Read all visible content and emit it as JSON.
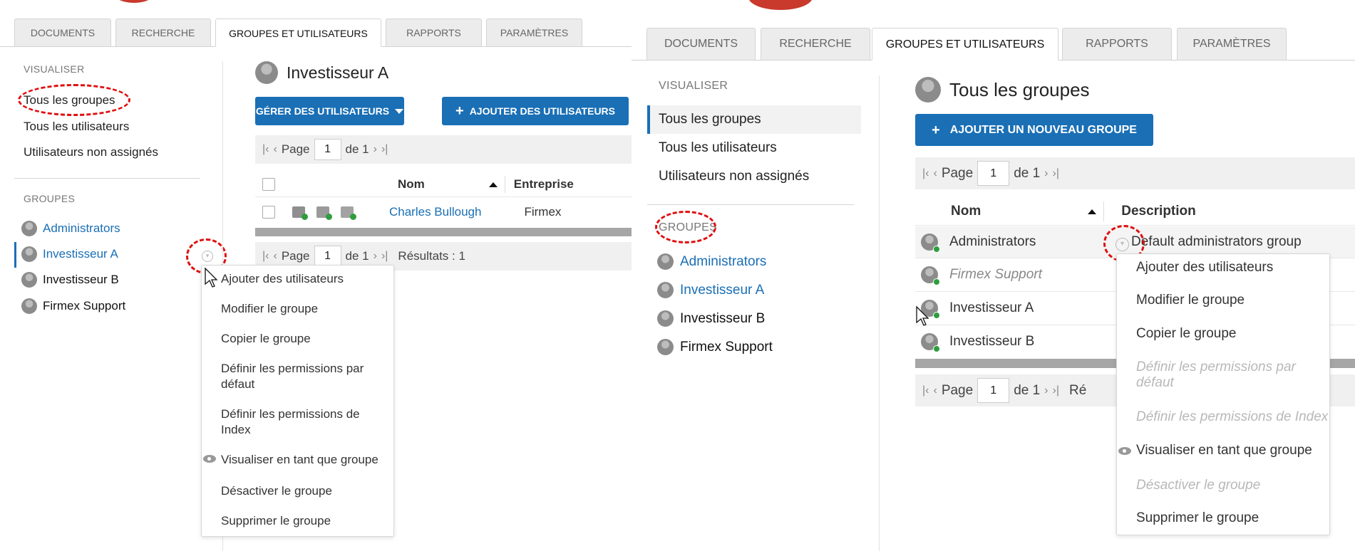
{
  "colors": {
    "accent": "#1a6fb5",
    "highlight": "#e01010",
    "success": "#2e9e3e",
    "logo": "#c9392c"
  },
  "tabs": [
    "DOCUMENTS",
    "RECHERCHE",
    "GROUPES ET UTILISATEURS",
    "RAPPORTS",
    "PARAMÈTRES"
  ],
  "active_tab": "GROUPES ET UTILISATEURS",
  "sidebar": {
    "visualiser_label": "VISUALISER",
    "links": [
      "Tous les groupes",
      "Tous les utilisateurs",
      "Utilisateurs non assignés"
    ],
    "groupes_label": "GROUPES",
    "groups": [
      "Administrators",
      "Investisseur A",
      "Investisseur B",
      "Firmex Support"
    ]
  },
  "left": {
    "title": "Investisseur A",
    "manage_button": "GÉRER DES UTILISATEURS",
    "add_button": "AJOUTER DES UTILISATEURS",
    "pager": {
      "page_label": "Page",
      "page_value": "1",
      "of_label": "de 1",
      "results": "Résultats : 1"
    },
    "columns": {
      "nom": "Nom",
      "entreprise": "Entreprise"
    },
    "rows": [
      {
        "name": "Charles Bullough",
        "company": "Firmex"
      }
    ],
    "menu": [
      {
        "label": "Ajouter des utilisateurs",
        "disabled": false
      },
      {
        "label": "Modifier le groupe",
        "disabled": false
      },
      {
        "label": "Copier le groupe",
        "disabled": false
      },
      {
        "label": "Définir les permissions par défaut",
        "disabled": false
      },
      {
        "label": "Définir les permissions de Index",
        "disabled": false
      },
      {
        "label": "Visualiser en tant que groupe",
        "disabled": false,
        "icon": "eye-icon"
      },
      {
        "label": "Désactiver le groupe",
        "disabled": false
      },
      {
        "label": "Supprimer le groupe",
        "disabled": false
      }
    ]
  },
  "right": {
    "title": "Tous les groupes",
    "add_group_button": "AJOUTER UN NOUVEAU GROUPE",
    "pager": {
      "page_label": "Page",
      "page_value": "1",
      "of_label": "de 1",
      "results": "Ré"
    },
    "columns": {
      "nom": "Nom",
      "description": "Description"
    },
    "rows": [
      {
        "name": "Administrators",
        "description": "Default administrators group"
      },
      {
        "name": "Firmex Support",
        "description": ""
      },
      {
        "name": "Investisseur A",
        "description": ""
      },
      {
        "name": "Investisseur B",
        "description": ""
      }
    ],
    "menu": [
      {
        "label": "Ajouter des utilisateurs",
        "disabled": false
      },
      {
        "label": "Modifier le groupe",
        "disabled": false
      },
      {
        "label": "Copier le groupe",
        "disabled": false
      },
      {
        "label": "Définir les permissions par défaut",
        "disabled": true
      },
      {
        "label": "Définir les permissions de Index",
        "disabled": true
      },
      {
        "label": "Visualiser en tant que groupe",
        "disabled": false,
        "icon": "eye-icon"
      },
      {
        "label": "Désactiver le groupe",
        "disabled": true
      },
      {
        "label": "Supprimer le groupe",
        "disabled": false
      }
    ]
  }
}
